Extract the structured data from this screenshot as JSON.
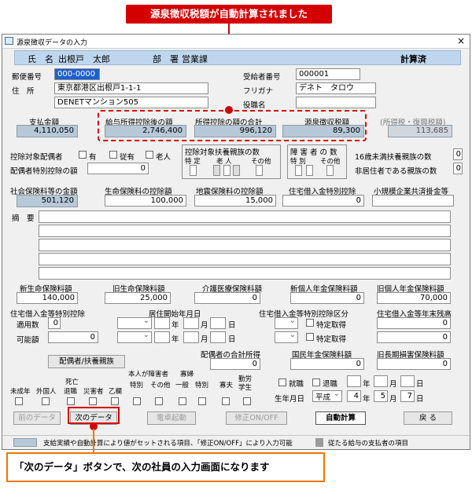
{
  "top_callout": "源泉徴収税額が自動計算されました",
  "bottom_callout": "「次のデータ」ボタンで、次の社員の入力画面になります",
  "window": {
    "title": "源泉徴収データの入力",
    "close": "×"
  },
  "header": {
    "name_label": "氏　名",
    "name_value": "出根戸　太郎",
    "dept_label": "部　署",
    "dept_value": "営業課",
    "status": "計算済"
  },
  "postal": {
    "label": "郵便番号",
    "value": "000-0000"
  },
  "address": {
    "label": "住　所",
    "line1": "東京都港区出根戸1-1-1",
    "line2": "DENETマンション505"
  },
  "recipient_no": {
    "label": "受給者番号",
    "value": "000001"
  },
  "furigana": {
    "label": "フリガナ",
    "value": "デネト　タロウ"
  },
  "position": {
    "label": "役職名",
    "value": ""
  },
  "amounts": {
    "payment_label": "支払金額",
    "payment": "4,110,050",
    "after_deduct_label": "給与所得控除後の額",
    "after_deduct": "2,746,400",
    "deduct_total_label": "所得控除の額の合計",
    "deduct_total": "996,120",
    "tax_label": "源泉徴収税額",
    "tax": "89,300",
    "inc_tax_label": "(所得税・復興税額)",
    "inc_tax": "113,685"
  },
  "spouse": {
    "label": "控除対象配偶者",
    "yes": "有",
    "coresident": "従有",
    "elderly": "老人",
    "special_label": "配偶者特別控除の額",
    "special_value": "0"
  },
  "dependents": {
    "label": "控除対象扶養親族の数",
    "special": "特 定",
    "elderly": "老 人",
    "other": "その他",
    "elderly_sub": "人"
  },
  "disabled": {
    "label": "障 害 者 の 数",
    "special": "特 別",
    "other": "その他"
  },
  "under16": {
    "label": "16歳未満扶養親族の数",
    "value": "0"
  },
  "nonresident": {
    "label": "非居住者である親族の数",
    "value": "0"
  },
  "row1": {
    "social_label": "社会保険料等の金額",
    "social": "501,120",
    "life_label": "生命保険料の控除額",
    "life": "100,000",
    "quake_label": "地震保険料の控除額",
    "quake": "15,000",
    "housing_label": "住宅借入金特別控除",
    "housing": "0",
    "smallbiz_label": "小規模企業共済掛金等",
    "smallbiz": ""
  },
  "summary": {
    "label": "摘　要"
  },
  "insurance": {
    "new_life_label": "新生命保険料額",
    "new_life": "140,000",
    "old_life_label": "旧生命保険料額",
    "old_life": "25,000",
    "care_label": "介護医療保険料額",
    "care": "0",
    "new_pension_label": "新個人年金保険料額",
    "new_pension": "0",
    "old_pension_label": "旧個人年金保険料額",
    "old_pension": "70,000"
  },
  "housing": {
    "count_label": "住宅借入金等特別控除",
    "applicable": "適用数",
    "applicable_value": "0",
    "possible": "可能額",
    "possible_value": "0",
    "start_label": "居住開始年月日",
    "year": "年",
    "month": "月",
    "day": "日",
    "category_label": "住宅借入金等特別控除区分",
    "special1": "特定取得",
    "special2": "特定取得",
    "balance_label": "住宅借入金等年末残高",
    "balance1": "0",
    "balance2": "0"
  },
  "spouse_btn": "配偶者/扶養親族",
  "spouse_total": {
    "label": "配偶者の合計所得",
    "value": "0"
  },
  "national_pension": {
    "label": "国民年金保険料額",
    "value": "0"
  },
  "old_longterm": {
    "label": "旧長期損害保険料額",
    "value": "0"
  },
  "flags": {
    "minor": "未成年",
    "foreigner": "外国人",
    "death_retire": "死亡退職",
    "disaster": "災害者",
    "b_column": "乙欄",
    "disabled_self": "本人が障害者",
    "special": "特別",
    "other": "その他",
    "widow": "寡婦",
    "general": "一般",
    "widow_special": "特別",
    "widower": "寡夫",
    "working_student": "勤労学生",
    "death_retire_top": "死亡",
    "death_retire_bot": "退職"
  },
  "employment": {
    "hire": "就職",
    "retire": "退職",
    "year": "年",
    "month": "月",
    "day": "日"
  },
  "birth": {
    "label": "生年月日",
    "era": "平成",
    "year": "4",
    "year_unit": "年",
    "month": "5",
    "month_unit": "月",
    "day": "7",
    "day_unit": "日"
  },
  "buttons": {
    "prev": "前のデータ",
    "next": "次のデータ",
    "seal": "電卓起動",
    "edit": "修正ON/OFF",
    "auto": "自動計算",
    "back": "戻 る"
  },
  "status_bar": {
    "note1": "支給実績や自動計算により値がセットされる項目、「修正ON/OFF」により入力可能",
    "note2": "従たる給与の支払者の項目"
  }
}
